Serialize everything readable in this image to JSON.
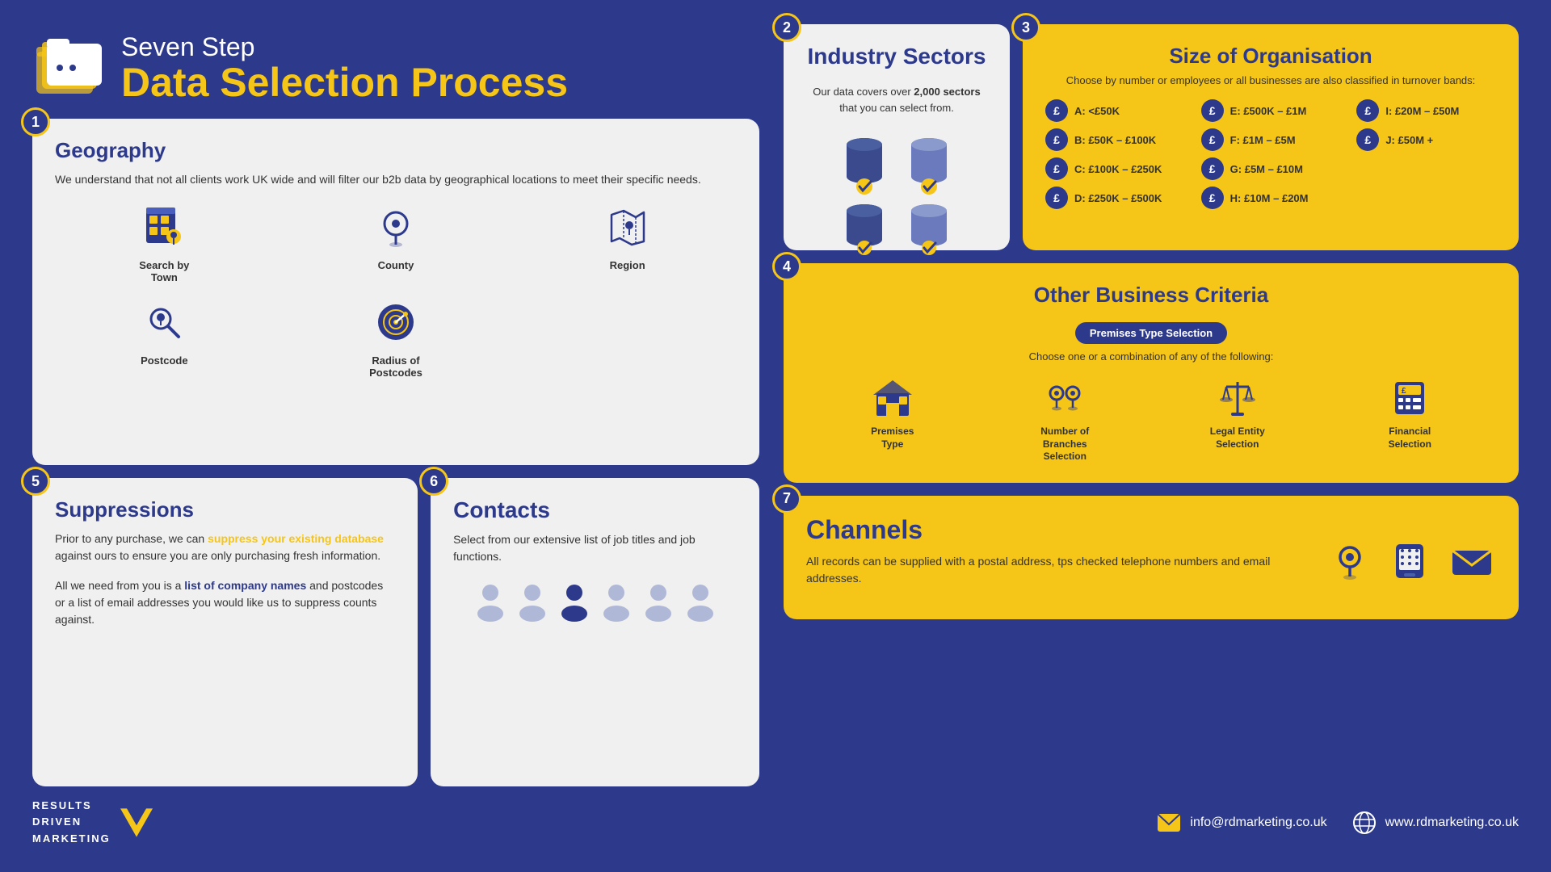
{
  "header": {
    "subtitle": "Seven Step",
    "title": "Data Selection Process"
  },
  "steps": {
    "step1": {
      "number": "1",
      "title": "Geography",
      "body": "We understand that not all clients work UK wide and will filter our b2b data by geographical locations to meet their specific needs.",
      "icons": [
        {
          "label": "Search by Town",
          "name": "search-by-town"
        },
        {
          "label": "County",
          "name": "county"
        },
        {
          "label": "Region",
          "name": "region"
        },
        {
          "label": "Postcode",
          "name": "postcode"
        },
        {
          "label": "Radius of Postcodes",
          "name": "radius-postcodes"
        }
      ]
    },
    "step2": {
      "number": "2",
      "title": "Industry Sectors",
      "body": "Our data covers over ",
      "highlight": "2,000 sectors",
      "body2": " that you can select from."
    },
    "step3": {
      "number": "3",
      "title": "Size of Organisation",
      "subtitle": "Choose by number or employees or all businesses are also classified in turnover bands:",
      "bands": [
        {
          "label": "A: <£50K"
        },
        {
          "label": "E: £500K – £1M"
        },
        {
          "label": "I: £20M – £50M"
        },
        {
          "label": "B: £50K – £100K"
        },
        {
          "label": "F: £1M – £5M"
        },
        {
          "label": "J: £50M +"
        },
        {
          "label": "C: £100K – £250K"
        },
        {
          "label": "G: £5M – £10M"
        },
        {
          "label": ""
        },
        {
          "label": "D: £250K – £500K"
        },
        {
          "label": "H: £10M – £20M"
        },
        {
          "label": ""
        }
      ]
    },
    "step4": {
      "number": "4",
      "title": "Other Business Criteria",
      "badge": "Premises Type Selection",
      "subtitle": "Choose one or a combination of any of the following:",
      "criteria": [
        {
          "label": "Premises Type",
          "name": "premises-type"
        },
        {
          "label": "Number of Branches Selection",
          "name": "branches-selection"
        },
        {
          "label": "Legal Entity Selection",
          "name": "legal-entity"
        },
        {
          "label": "Financial Selection",
          "name": "financial-selection"
        }
      ]
    },
    "step5": {
      "number": "5",
      "title": "Suppressions",
      "body1": "Prior to any purchase, we can ",
      "highlight1": "suppress your existing database",
      "body2": " against ours to ensure you are only purchasing fresh information.",
      "body3": "All we need from you is a ",
      "highlight2": "list of company names",
      "body4": " and postcodes or a list of email addresses you would like us to suppress counts against."
    },
    "step6": {
      "number": "6",
      "title": "Contacts",
      "body": "Select from our extensive list of job titles and job functions."
    },
    "step7": {
      "number": "7",
      "title": "Channels",
      "body": "All records can be supplied with a postal address, tps checked telephone numbers and email addresses."
    }
  },
  "footer": {
    "logo_lines": [
      "RESULTS",
      "DRIVEN",
      "MARKETING"
    ],
    "email": "info@rdmarketing.co.uk",
    "website": "www.rdmarketing.co.uk"
  }
}
